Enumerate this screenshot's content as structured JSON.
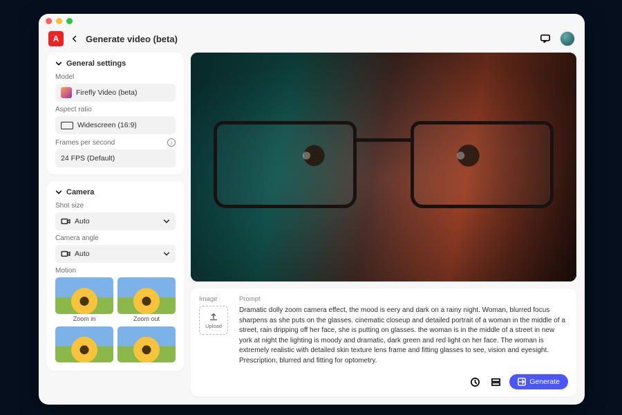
{
  "header": {
    "page_title": "Generate video (beta)"
  },
  "sidebar": {
    "general": {
      "title": "General settings",
      "model_label": "Model",
      "model_value": "Firefly Video (beta)",
      "aspect_label": "Aspect ratio",
      "aspect_value": "Widescreen (16:9)",
      "fps_label": "Frames per second",
      "fps_value": "24 FPS (Default)"
    },
    "camera": {
      "title": "Camera",
      "shot_label": "Shot size",
      "shot_value": "Auto",
      "angle_label": "Camera angle",
      "angle_value": "Auto",
      "motion_label": "Motion",
      "motion_items": [
        {
          "label": "Zoom in"
        },
        {
          "label": "Zoom out"
        },
        {
          "label": ""
        },
        {
          "label": ""
        }
      ]
    }
  },
  "prompt": {
    "image_label": "Image",
    "upload_label": "Upload",
    "prompt_label": "Prompt",
    "prompt_text": "Dramatic dolly zoom camera effect, the mood is eery and dark on a rainy night. Woman, blurred focus sharpens as she puts on the glasses. cinematic closeup and detailed portrait of a woman in the middle of a street, rain dripping off her face, she is putting on glasses. the woman is in the middle of a street in new york at night the lighting is moody and dramatic, dark green and red light on her face. The woman is extremely realistic with detailed skin texture lens frame and fitting glasses to see, vision and eyesight. Prescription, blurred and fitting for optometry.",
    "generate_label": "Generate"
  },
  "colors": {
    "accent": "#4a56ff",
    "brand": "#ed2224"
  }
}
